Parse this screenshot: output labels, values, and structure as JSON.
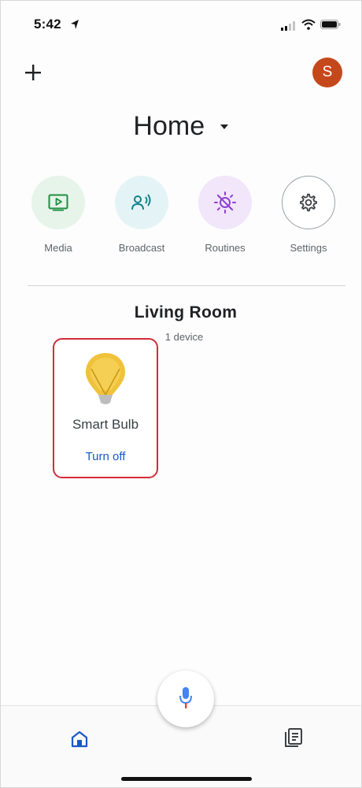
{
  "status_bar": {
    "time": "5:42"
  },
  "header": {
    "add_icon": "plus-icon",
    "avatar_initial": "S",
    "avatar_color": "#c5481d"
  },
  "home": {
    "title": "Home"
  },
  "shortcuts": [
    {
      "label": "Media",
      "icon": "media-icon",
      "color": "#e6f4ea"
    },
    {
      "label": "Broadcast",
      "icon": "broadcast-icon",
      "color": "#e4f4f6"
    },
    {
      "label": "Routines",
      "icon": "routines-icon",
      "color": "#f1e6fa"
    },
    {
      "label": "Settings",
      "icon": "gear-icon",
      "color": "#ffffff"
    }
  ],
  "room": {
    "name": "Living Room",
    "device_count": "1 device",
    "devices": [
      {
        "name": "Smart Bulb",
        "action": "Turn off",
        "icon": "bulb-icon",
        "highlight_color": "#d22b3a"
      }
    ]
  },
  "bottom_nav": {
    "items": [
      {
        "icon": "home-icon",
        "active": true
      },
      {
        "icon": "feed-icon",
        "active": false
      }
    ],
    "mic_icon": "mic-icon"
  },
  "colors": {
    "accent_blue": "#1a57c8",
    "bulb_yellow": "#f0c23b"
  }
}
